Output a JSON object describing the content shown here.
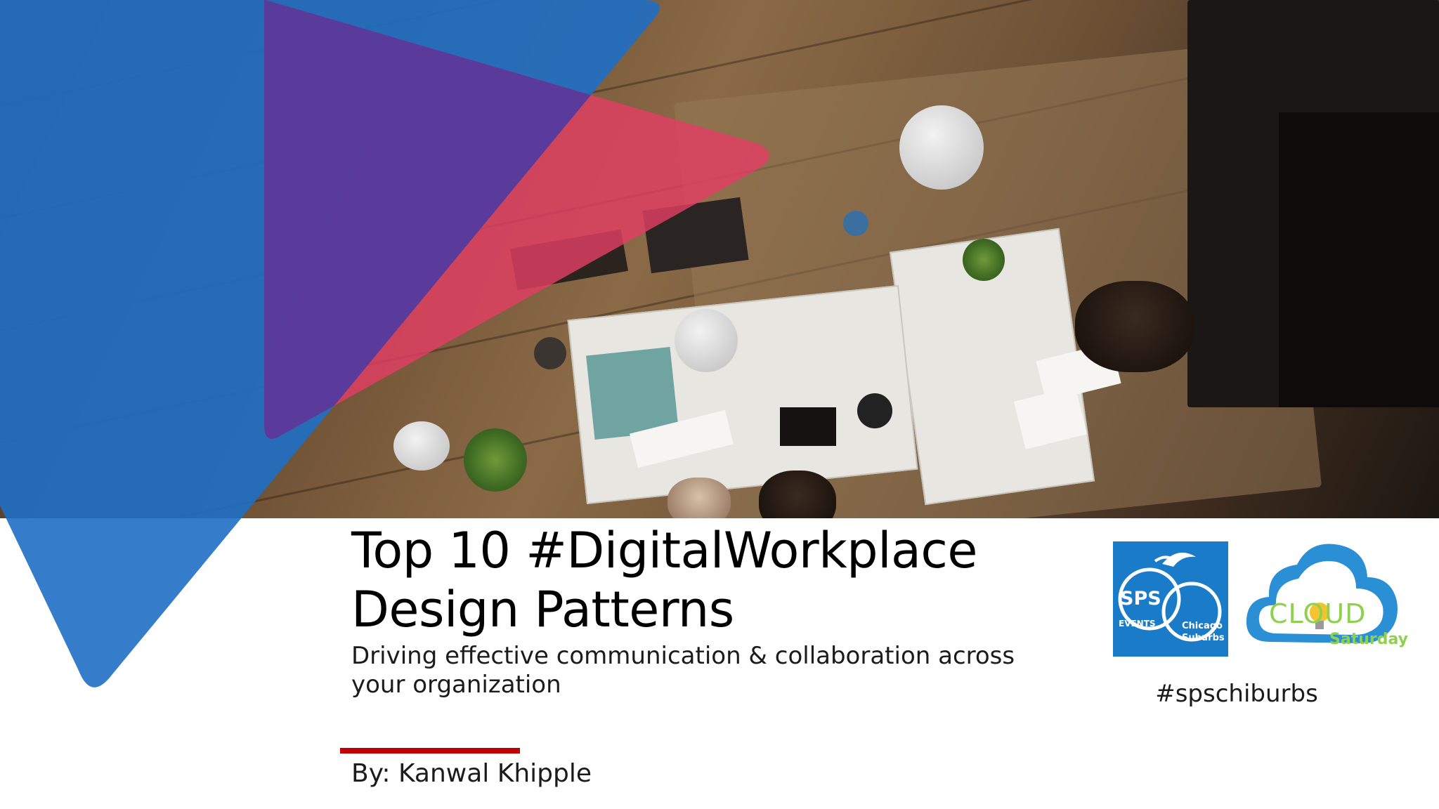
{
  "slide": {
    "title_line1": "Top 10 #DigitalWorkplace",
    "title_line2": "Design Patterns",
    "subtitle_line1": "Driving effective communication & collaboration across",
    "subtitle_line2": "your organization",
    "author": "By: Kanwal Khipple",
    "hashtag": "#spschiburbs"
  },
  "logos": {
    "sps": {
      "main": "SPS",
      "sub": "EVENTS",
      "city_line1": "Chicago",
      "city_line2": "Suburbs"
    },
    "cloud": {
      "word": "CLOUD",
      "sub": "Saturday"
    }
  },
  "colors": {
    "blue_triangle": "#1f6fc4",
    "pink_triangle": "#e23e63",
    "purple_overlap": "#4b3aa0",
    "accent_red": "#c00000",
    "sps_blue": "#1a7bc9",
    "cloud_blue": "#2b8fd6",
    "cloud_green": "#8fd14f"
  }
}
